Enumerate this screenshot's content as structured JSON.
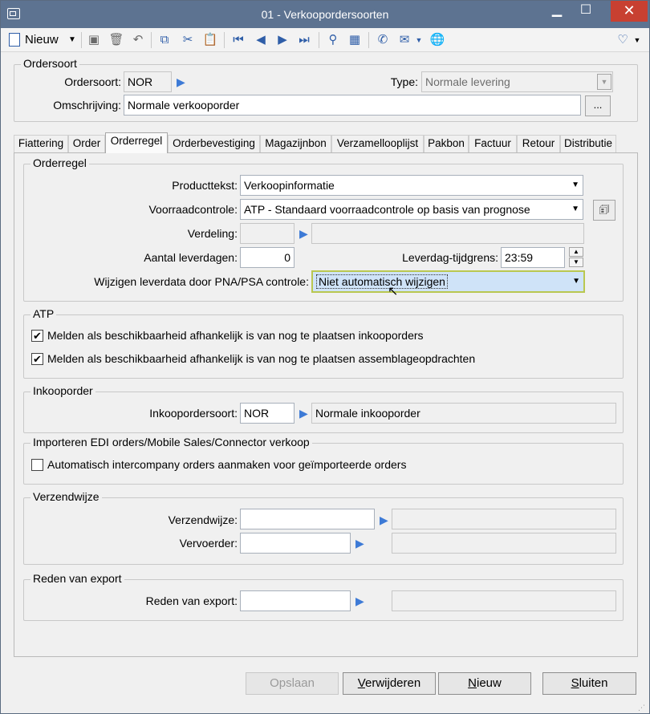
{
  "window": {
    "title": "01 - Verkoopordersoorten"
  },
  "toolbar": {
    "new_label": "Nieuw",
    "icons": [
      "save-icon",
      "delete-icon",
      "undo-icon",
      "copy-icon",
      "cut-icon",
      "paste-icon",
      "first-record-icon",
      "previous-record-icon",
      "next-record-icon",
      "last-record-icon",
      "search-binoculars-icon",
      "grid-icon",
      "phone-icon",
      "email-icon",
      "web-icon",
      "favorite-icon"
    ]
  },
  "ordersoort": {
    "group_title": "Ordersoort",
    "code_label": "Ordersoort:",
    "code_value": "NOR",
    "type_label": "Type:",
    "type_value": "Normale levering",
    "desc_label": "Omschrijving:",
    "desc_value": "Normale verkooporder",
    "ellipsis": "..."
  },
  "tabs": [
    "Fiattering",
    "Order",
    "Orderregel",
    "Orderbevestiging",
    "Magazijnbon",
    "Verzamellooplijst",
    "Pakbon",
    "Factuur",
    "Retour",
    "Distributie"
  ],
  "active_tab": "Orderregel",
  "orderregel": {
    "group_title": "Orderregel",
    "producttekst_label": "Producttekst:",
    "producttekst_value": "Verkoopinformatie",
    "voorraad_label": "Voorraadcontrole:",
    "voorraad_value": "ATP - Standaard voorraadcontrole op basis van prognose",
    "verdeling_label": "Verdeling:",
    "verdeling_value": "",
    "aantal_label": "Aantal leverdagen:",
    "aantal_value": "0",
    "tijdgrens_label": "Leverdag-tijdgrens:",
    "tijdgrens_value": "23:59",
    "wijzigen_label": "Wijzigen leverdata door PNA/PSA controle:",
    "wijzigen_value": "Niet automatisch wijzigen"
  },
  "atp": {
    "group_title": "ATP",
    "check1_label": "Melden als beschikbaarheid afhankelijk is van nog te plaatsen inkooporders",
    "check1_checked": true,
    "check2_label": "Melden als beschikbaarheid afhankelijk is van nog te plaatsen assemblageopdrachten",
    "check2_checked": true
  },
  "inkooporder": {
    "group_title": "Inkooporder",
    "soort_label": "Inkoopordersoort:",
    "soort_value": "NOR",
    "soort_desc": "Normale inkooporder"
  },
  "edi": {
    "group_title": "Importeren EDI orders/Mobile Sales/Connector verkoop",
    "check_label": "Automatisch intercompany orders aanmaken voor geïmporteerde orders",
    "check_checked": false
  },
  "verzendwijze": {
    "group_title": "Verzendwijze",
    "verzend_label": "Verzendwijze:",
    "verzend_value": "",
    "vervoerder_label": "Vervoerder:",
    "vervoerder_value": ""
  },
  "export": {
    "group_title": "Reden van export",
    "reden_label": "Reden van export:",
    "reden_value": ""
  },
  "buttons": {
    "save": "Opslaan",
    "delete": "Verwijderen",
    "new": "Nieuw",
    "close": "Sluiten"
  }
}
